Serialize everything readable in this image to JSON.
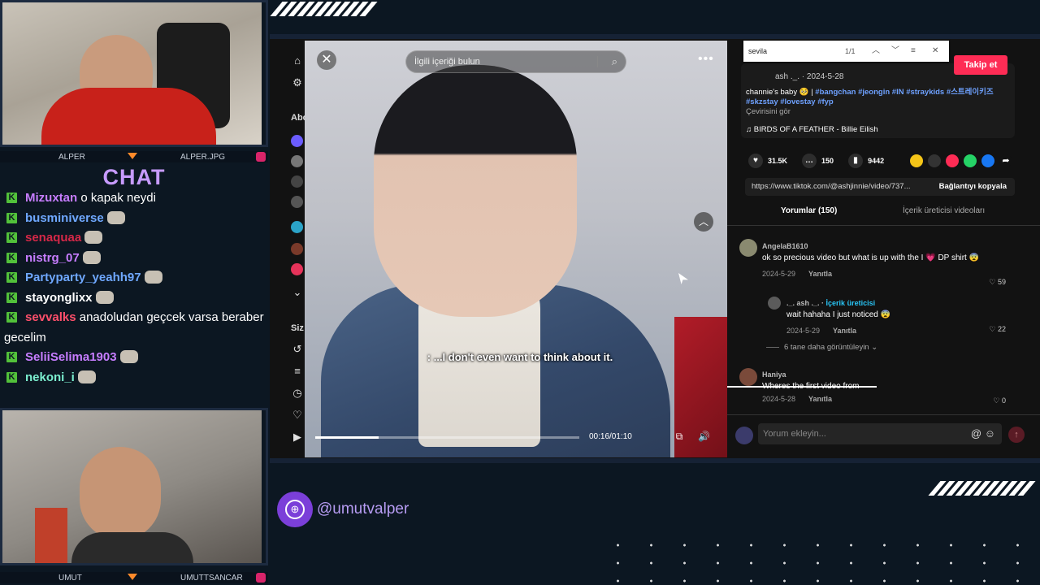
{
  "cams": {
    "top_name_left": "ALPER",
    "top_name_right": "ALPER.JPG",
    "bottom_name_left": "UMUT",
    "bottom_name_right": "UMUTTSANCAR"
  },
  "chat": {
    "title": "CHAT",
    "messages": [
      {
        "user": "Mizuxtan",
        "text": "o kapak neydi",
        "color": "#c77dff",
        "emote": false
      },
      {
        "user": "busminiverse",
        "text": "",
        "color": "#6fa8ff",
        "emote": true
      },
      {
        "user": "senaquaa",
        "text": "",
        "color": "#d62848",
        "emote": true
      },
      {
        "user": "nistrg_07",
        "text": "",
        "color": "#c77dff",
        "emote": true
      },
      {
        "user": "Partyparty_yeahh97",
        "text": "",
        "color": "#6fa8ff",
        "emote": true
      },
      {
        "user": "stayonglixx",
        "text": "",
        "color": "#ffffff",
        "emote": true
      },
      {
        "user": "sevvalks",
        "text": "anadoludan geçcek varsa beraber gecelim",
        "color": "#ff4f6b",
        "emote": false
      },
      {
        "user": "SeliiSelima1903",
        "text": "",
        "color": "#c77dff",
        "emote": true
      },
      {
        "user": "nekoni_i",
        "text": "",
        "color": "#7cf0d0",
        "emote": true
      }
    ]
  },
  "sidebar": {
    "label_a": "Abo",
    "label_b": "Siz"
  },
  "video": {
    "search_placeholder": "İlgili içeriği bulun",
    "subtitle": ": ...I don't even want to think about it.",
    "time": "00:16/01:10",
    "progress": 0.24
  },
  "panel": {
    "find_query": "sevila",
    "find_count": "1/1",
    "follow": "Takip et",
    "author": "ash ._. · 2024-5-28",
    "desc_prefix": "channie's baby 🥺 | ",
    "desc_tags": "#bangchan #jeongin #IN #straykids #스트레이키즈 #skzstay #lovestay #fyp",
    "translate": "Çevirisini gör",
    "music": "BIRDS OF A FEATHER - Billie Eilish",
    "likes": "31.5K",
    "comments_count": "150",
    "saves": "9442",
    "link": "https://www.tiktok.com/@ashjinnie/video/737...",
    "copy": "Bağlantıyı kopyala",
    "tab_comments": "Yorumlar (150)",
    "tab_creator": "İçerik üreticisi videoları",
    "c1_name": "AngelaB1610",
    "c1_text": "ok so precious video but what is up with the I 💗 DP shirt 😨",
    "c1_date": "2024-5-29",
    "c1_reply": "Yanıtla",
    "c1_likes": "59",
    "r1_name": "._. ash ._. ·",
    "r1_badge": "İçerik üreticisi",
    "r1_text": "wait hahaha I just noticed 😨",
    "r1_date": "2024-5-29",
    "r1_reply": "Yanıtla",
    "r1_likes": "22",
    "more_replies": "6 tane daha görüntüleyin ⌄",
    "c2_name": "Haniya",
    "c2_text": "Wheres the first video from",
    "c2_date": "2024-5-28",
    "c2_reply": "Yanıtla",
    "c2_likes": "0",
    "input_placeholder": "Yorum ekleyin..."
  },
  "social": {
    "handle": "@umutvalper"
  }
}
